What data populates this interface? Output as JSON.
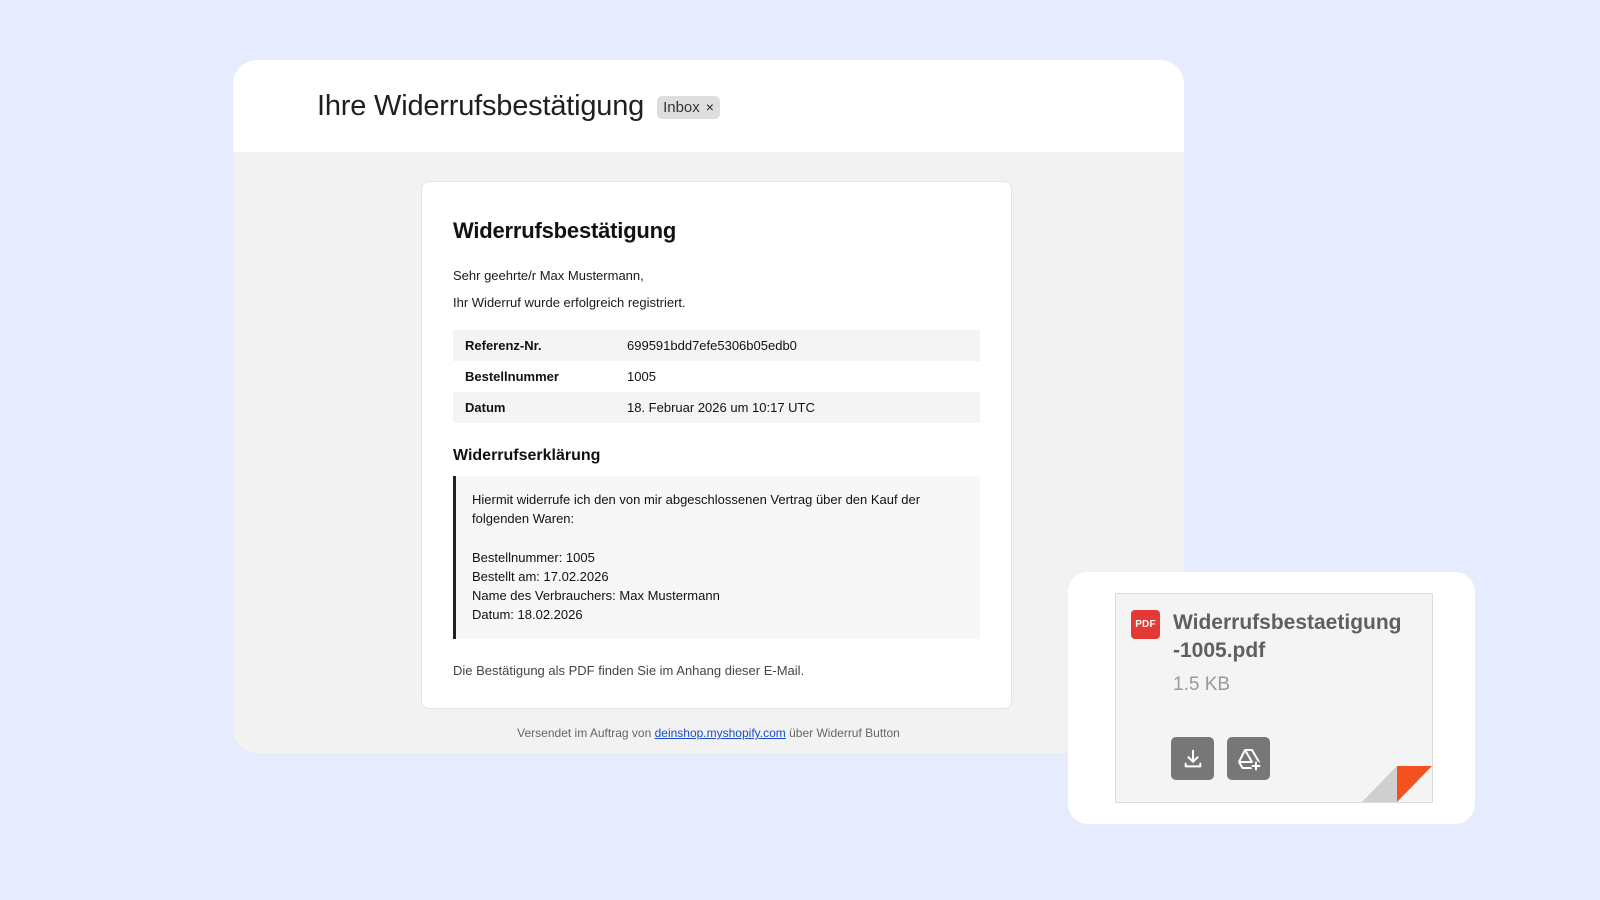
{
  "email": {
    "subject": "Ihre Widerrufsbestätigung",
    "label_chip": "Inbox",
    "label_chip_close": "×",
    "card": {
      "title": "Widerrufsbestätigung",
      "greeting": "Sehr geehrte/r Max Mustermann,",
      "intro": "Ihr Widerruf wurde erfolgreich registriert.",
      "details": [
        {
          "label": "Referenz-Nr.",
          "value": "699591bdd7efe5306b05edb0"
        },
        {
          "label": "Bestellnummer",
          "value": "1005"
        },
        {
          "label": "Datum",
          "value": "18. Februar 2026 um 10:17 UTC"
        }
      ],
      "declaration_title": "Widerrufserklärung",
      "declaration": {
        "line1": "Hiermit widerrufe ich den von mir abgeschlossenen Vertrag über den Kauf der",
        "line2": "folgenden Waren:",
        "order": "Bestellnummer: 1005",
        "ordered_on": "Bestellt am: 17.02.2026",
        "consumer": "Name des Verbrauchers: Max Mustermann",
        "date": "Datum: 18.02.2026"
      },
      "note": "Die Bestätigung als PDF finden Sie im Anhang dieser E-Mail."
    },
    "footer": {
      "prefix": "Versendet im Auftrag von",
      "link": "deinshop.myshopify.com",
      "suffix": "über Widerruf Button"
    }
  },
  "attachment": {
    "badge": "PDF",
    "name_line1": "Widerrufsbestaetigung",
    "name_line2": "-1005.pdf",
    "size": "1.5 KB",
    "actions": [
      "download-icon",
      "add-to-drive-icon"
    ]
  },
  "colors": {
    "page_bg": "#e6ebfd",
    "pdf_red": "#e53935",
    "fold_red": "#f4511e",
    "link_blue": "#1a4cc8"
  }
}
